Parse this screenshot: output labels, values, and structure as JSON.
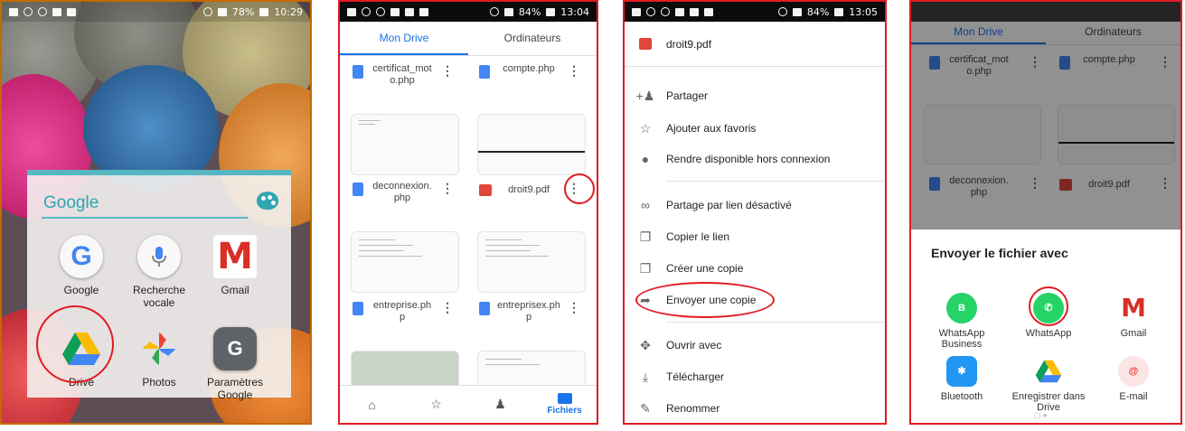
{
  "panel1": {
    "status_bar": {
      "battery": "78%",
      "time": "10:29"
    },
    "widget": {
      "search_label": "Google"
    },
    "apps": [
      {
        "label": "Google"
      },
      {
        "label": "Recherche vocale"
      },
      {
        "label": "Gmail"
      },
      {
        "label": "Drive"
      },
      {
        "label": "Photos"
      },
      {
        "label": "Paramètres Google"
      }
    ]
  },
  "panel2": {
    "status_bar": {
      "battery": "84%",
      "time": "13:04"
    },
    "tabs": [
      {
        "label": "Mon Drive"
      },
      {
        "label": "Ordinateurs"
      }
    ],
    "files": [
      {
        "name": "certificat_moto.php"
      },
      {
        "name": "compte.php"
      },
      {
        "name": "deconnexion.php"
      },
      {
        "name": "droit9.pdf",
        "badge": "PDF"
      },
      {
        "name": "entreprise.php"
      },
      {
        "name": "entreprisex.php"
      }
    ],
    "bottom_nav": {
      "files_label": "Fichiers"
    }
  },
  "panel3": {
    "status_bar": {
      "battery": "84%",
      "time": "13:05"
    },
    "file": {
      "name": "droit9.pdf",
      "badge": "PDF"
    },
    "menu": [
      {
        "label": "Partager",
        "icon": "person-add-icon"
      },
      {
        "label": "Ajouter aux favoris",
        "icon": "star-icon"
      },
      {
        "label": "Rendre disponible hors connexion",
        "icon": "offline-icon"
      },
      {
        "label": "Partage par lien désactivé",
        "icon": "link-off-icon"
      },
      {
        "label": "Copier le lien",
        "icon": "copy-icon"
      },
      {
        "label": "Créer une copie",
        "icon": "file-copy-icon"
      },
      {
        "label": "Envoyer une copie",
        "icon": "send-icon"
      },
      {
        "label": "Ouvrir avec",
        "icon": "open-with-icon"
      },
      {
        "label": "Télécharger",
        "icon": "download-icon"
      },
      {
        "label": "Renommer",
        "icon": "rename-icon"
      }
    ]
  },
  "panel4": {
    "tabs": [
      {
        "label": "Mon Drive"
      },
      {
        "label": "Ordinateurs"
      }
    ],
    "files": [
      {
        "name": "certificat_moto.php"
      },
      {
        "name": "compte.php"
      },
      {
        "name": "deconnexion.php"
      },
      {
        "name": "droit9.pdf",
        "badge": "PDF"
      }
    ],
    "sheet_title": "Envoyer le fichier avec",
    "targets": [
      {
        "label": "WhatsApp Business",
        "glyph": "B"
      },
      {
        "label": "WhatsApp",
        "glyph": ""
      },
      {
        "label": "Gmail",
        "glyph": "M"
      },
      {
        "label": "Bluetooth",
        "glyph": "✱"
      },
      {
        "label": "Enregistrer dans Drive",
        "glyph": ""
      },
      {
        "label": "E-mail",
        "glyph": "@"
      }
    ]
  },
  "colors": {
    "drive_blue": "#1a73e8",
    "annotation_red": "#e11b22",
    "widget_teal": "#2ba6b4",
    "whatsapp_green": "#25d366",
    "gmail_red": "#d93025"
  }
}
